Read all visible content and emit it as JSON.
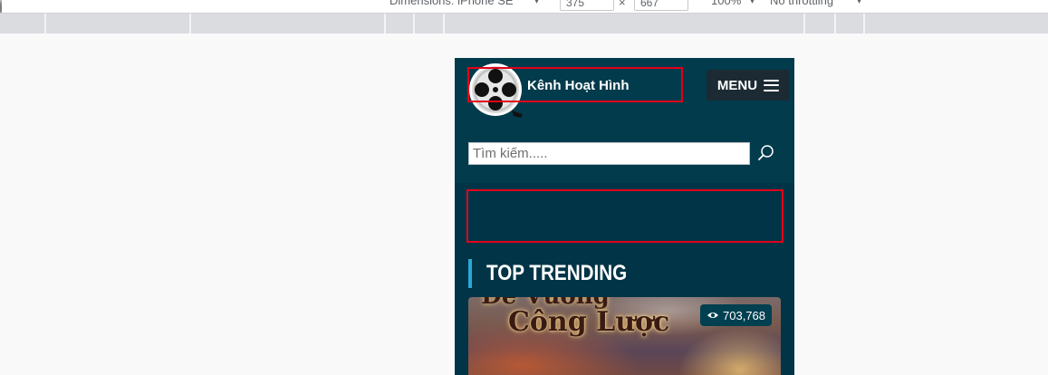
{
  "devtools": {
    "dimensions_label": "Dimensions: iPhone SE",
    "width": "375",
    "times": "×",
    "height": "667",
    "zoom": "100%",
    "throttling": "No throttling",
    "caret": "▾"
  },
  "header": {
    "brand": "Kênh Hoạt Hình",
    "menu_label": "MENU",
    "search_placeholder": "Tìm kiếm....."
  },
  "trending": {
    "title": "TOP TRENDING",
    "card": {
      "title_top": "Đế Vương",
      "title": "Công Lược",
      "views": "703,768"
    }
  },
  "colors": {
    "header_bg": "#023b4c",
    "page_bg": "#013446",
    "accent": "#29a9d6",
    "highlight": "#e3001b"
  },
  "icons": [
    "logo-film-reel-icon",
    "menu-icon",
    "search-icon",
    "eye-icon",
    "rotate-icon"
  ]
}
